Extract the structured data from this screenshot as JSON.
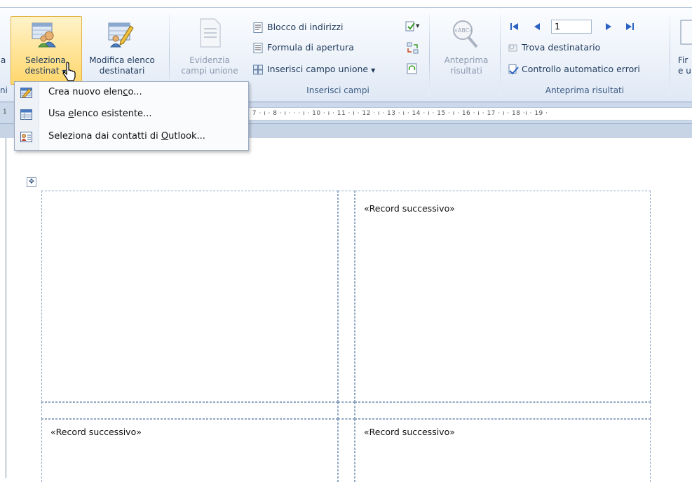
{
  "ribbon": {
    "left_edge_fragments": {
      "top": "a",
      "bottom": "ni"
    },
    "mailings": {
      "select_recipients": {
        "line1": "Seleziona",
        "line2": "destinat"
      },
      "edit_list": {
        "line1": "Modifica elenco",
        "line2": "destinatari"
      },
      "highlight_fields": {
        "line1": "Evidenzia",
        "line2": "campi unione"
      },
      "address_block": "Blocco di indirizzi",
      "greeting_line": "Formula di apertura",
      "insert_merge_field": "Inserisci campo unione",
      "write_insert_group": "Inserisci campi",
      "preview": {
        "line1": "Anteprima",
        "line2": "risultati"
      },
      "record_number": "1",
      "find_recipient": "Trova destinatario",
      "auto_check": "Controllo automatico errori",
      "preview_group": "Anteprima risultati",
      "right_edge_fragments": {
        "line1": "Fir",
        "line2": "e u"
      }
    }
  },
  "dropdown": {
    "items": [
      {
        "pre": "Crea nuovo elen",
        "key": "c",
        "post": "o..."
      },
      {
        "pre": "Usa ",
        "key": "e",
        "post": "lenco esistente..."
      },
      {
        "pre": "Seleziona dai contatti di ",
        "key": "O",
        "post": "utlook..."
      }
    ]
  },
  "ruler": {
    "left_mark": "1",
    "text": "· ı · 7 · ı · 8 · ı ·  ·  · ı · 10 · ı · 11 · ı · 12 · ı · 13 · ı · 14 · ı · 15 · ı · 16 · ı · 17 · ı · 18 ·ı · 19 ·"
  },
  "document": {
    "labels": [
      {
        "text": ""
      },
      {
        "text": "«Record successivo»"
      },
      {
        "text": "«Record successivo»"
      },
      {
        "text": "«Record successivo»"
      }
    ]
  },
  "colors": {
    "ribbon_text": "#1e395b",
    "selected_highlight": "#ffd66b",
    "grid_border": "#8fa6c4"
  }
}
